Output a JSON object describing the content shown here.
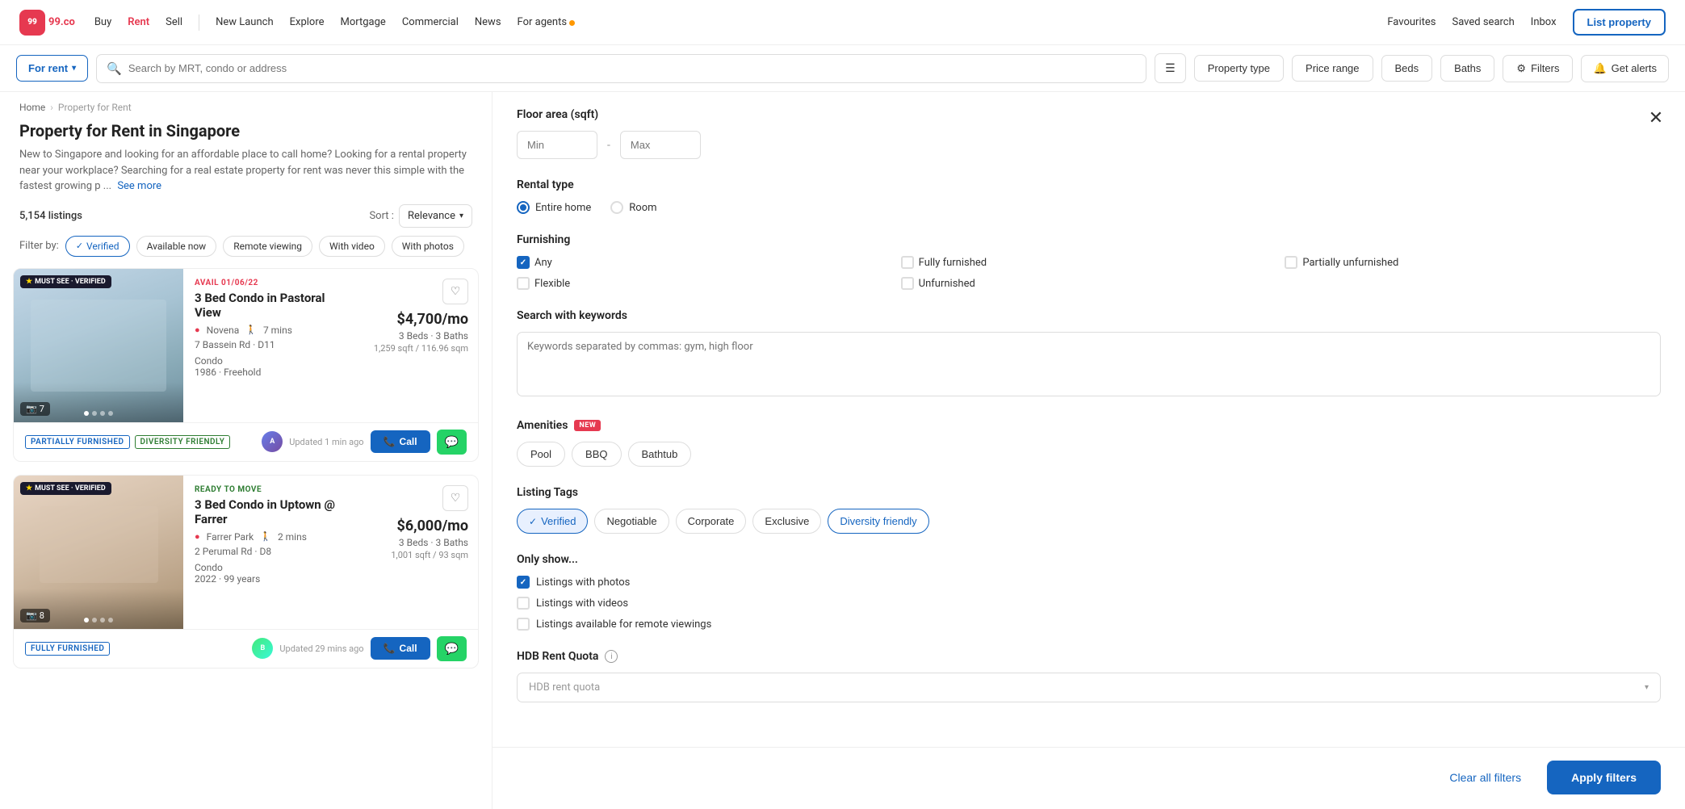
{
  "nav": {
    "logo": "99.co",
    "links": [
      "Buy",
      "Rent",
      "Sell",
      "New Launch",
      "Explore",
      "Mortgage",
      "Commercial",
      "News",
      "For agents"
    ],
    "right_links": [
      "Favourites",
      "Saved search",
      "Inbox"
    ],
    "list_property": "List property"
  },
  "search_bar": {
    "for_rent": "For rent",
    "placeholder": "Search by MRT, condo or address",
    "filter_pills": [
      "Property type",
      "Price range",
      "Beds",
      "Baths"
    ],
    "filters_label": "Filters",
    "get_alerts": "Get alerts"
  },
  "breadcrumb": {
    "home": "Home",
    "current": "Property for Rent"
  },
  "page": {
    "title": "Property for Rent in Singapore",
    "description": "New to Singapore and looking for an affordable place to call home? Looking for a rental property near your workplace? Searching for a real estate property for rent was never this simple with the fastest growing p ...",
    "see_more": "See more",
    "listings_count": "5,154 listings",
    "sort_label": "Sort :",
    "sort_value": "Relevance"
  },
  "filter_by": {
    "label": "Filter by:",
    "tags": [
      {
        "name": "Verified",
        "active": true
      },
      {
        "name": "Available now",
        "active": false
      },
      {
        "name": "Remote viewing",
        "active": false
      },
      {
        "name": "With video",
        "active": false
      },
      {
        "name": "With photos",
        "active": false
      }
    ]
  },
  "listings": [
    {
      "id": 1,
      "badge": "MUST SEE · VERIFIED",
      "avail_date": "AVAIL 01/06/22",
      "title": "3 Bed Condo in Pastoral View",
      "area": "Novena",
      "walk_time": "7 mins",
      "address": "7 Bassein Rd · D11",
      "type": "Condo",
      "year_tenure": "1986 · Freehold",
      "price": "$4,700/mo",
      "beds": "3 Beds",
      "baths": "3 Baths",
      "sqft": "1,259 sqft / 116.96 sqm",
      "img_count": "7",
      "tags": [
        "PARTIALLY FURNISHED",
        "DIVERSITY FRIENDLY"
      ],
      "updated": "Updated 1 min ago",
      "img_bg": "img-bg-1"
    },
    {
      "id": 2,
      "badge": "MUST SEE · VERIFIED",
      "avail_date": "READY TO MOVE",
      "title": "3 Bed Condo in Uptown @ Farrer",
      "area": "Farrer Park",
      "walk_time": "2 mins",
      "address": "2 Perumal Rd · D8",
      "type": "Condo",
      "year_tenure": "2022 · 99 years",
      "price": "$6,000/mo",
      "beds": "3 Beds",
      "baths": "3 Baths",
      "sqft": "1,001 sqft / 93 sqm",
      "img_count": "8",
      "tags": [
        "FULLY FURNISHED"
      ],
      "updated": "Updated 29 mins ago",
      "img_bg": "img-bg-2"
    }
  ],
  "filters_panel": {
    "floor_area": {
      "label": "Floor area (sqft)",
      "min_placeholder": "Min",
      "dash": "-",
      "max_placeholder": "Max"
    },
    "rental_type": {
      "label": "Rental type",
      "options": [
        "Entire home",
        "Room"
      ],
      "selected": "Entire home"
    },
    "furnishing": {
      "label": "Furnishing",
      "options": [
        {
          "name": "Any",
          "checked": true
        },
        {
          "name": "Fully furnished",
          "checked": false
        },
        {
          "name": "Partially unfurnished",
          "checked": false
        },
        {
          "name": "Flexible",
          "checked": false
        },
        {
          "name": "Unfurnished",
          "checked": false
        }
      ]
    },
    "keywords": {
      "label": "Search with keywords",
      "placeholder": "Keywords separated by commas: gym, high floor"
    },
    "amenities": {
      "label": "Amenities",
      "badge": "NEW",
      "options": [
        "Pool",
        "BBQ",
        "Bathtub"
      ]
    },
    "listing_tags": {
      "label": "Listing Tags",
      "tags": [
        {
          "name": "Verified",
          "active": true
        },
        {
          "name": "Negotiable",
          "active": false
        },
        {
          "name": "Corporate",
          "active": false
        },
        {
          "name": "Exclusive",
          "active": false
        },
        {
          "name": "Diversity friendly",
          "active_outline": true
        }
      ]
    },
    "only_show": {
      "label": "Only show...",
      "options": [
        {
          "name": "Listings with photos",
          "checked": true
        },
        {
          "name": "Listings with videos",
          "checked": false
        },
        {
          "name": "Listings available for remote viewings",
          "checked": false
        }
      ]
    },
    "hdb_rent": {
      "label": "HDB Rent Quota",
      "placeholder": "HDB rent quota"
    },
    "footer": {
      "clear_all": "Clear all filters",
      "apply": "Apply filters"
    }
  }
}
